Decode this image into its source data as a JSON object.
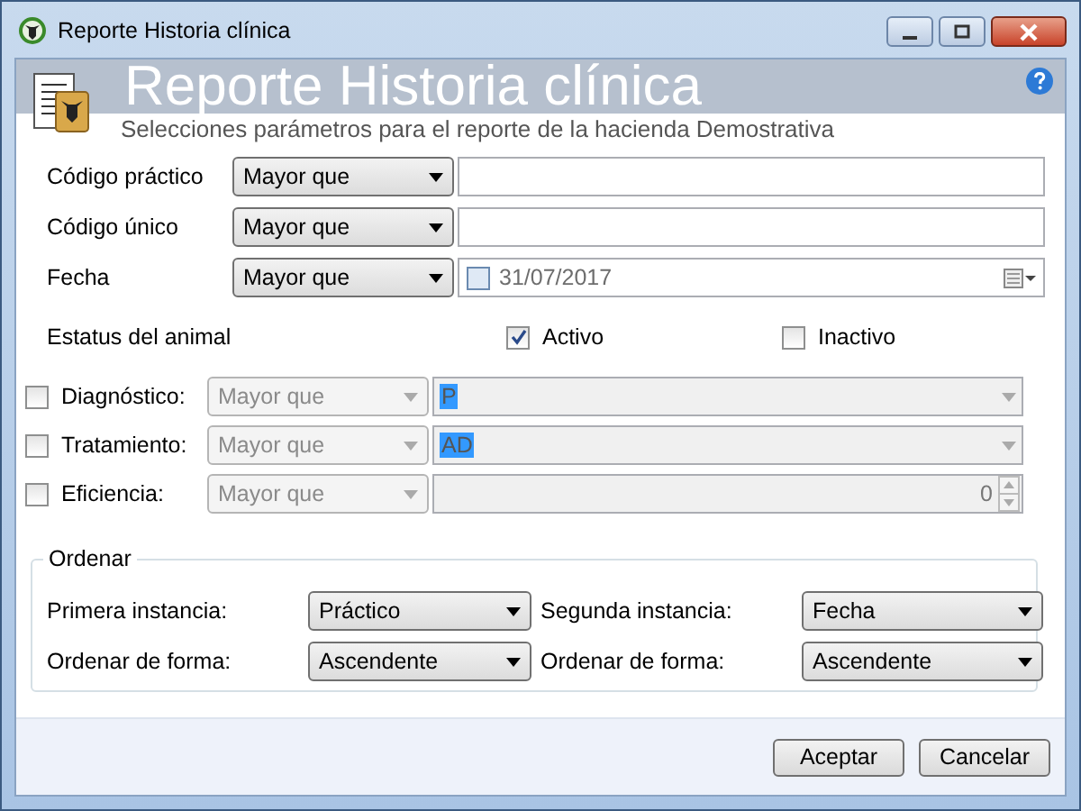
{
  "window": {
    "title": "Reporte Historia clínica"
  },
  "header": {
    "title": "Reporte Historia clínica",
    "subtitle": "Selecciones parámetros para el reporte de la hacienda Demostrativa"
  },
  "filters": [
    {
      "kind": "text",
      "label": "Código práctico",
      "operator": "Mayor que"
    },
    {
      "kind": "text",
      "label": "Código único",
      "operator": "Mayor que"
    },
    {
      "kind": "date",
      "label": "Fecha",
      "operator": "Mayor que",
      "checked": false,
      "value": "31/07/2017"
    }
  ],
  "status": {
    "label": "Estatus del animal",
    "options": [
      {
        "label": "Activo",
        "checked": true
      },
      {
        "label": "Inactivo",
        "checked": false
      }
    ]
  },
  "optional_filters": [
    {
      "kind": "combo",
      "label": "Diagnóstico:",
      "checked": false,
      "operator": "Mayor que",
      "value": "P",
      "text_selected": true
    },
    {
      "kind": "combo",
      "label": "Tratamiento:",
      "checked": false,
      "operator": "Mayor que",
      "value": "AD",
      "text_selected": true
    },
    {
      "kind": "spin",
      "label": "Eficiencia:",
      "checked": false,
      "operator": "Mayor que",
      "value": "0",
      "text_selected": false
    }
  ],
  "sort": {
    "title": "Ordenar",
    "fields": [
      {
        "label": "Primera instancia:",
        "value": "Práctico"
      },
      {
        "label": "Segunda instancia:",
        "value": "Fecha"
      },
      {
        "label": "Ordenar de forma:",
        "value": "Ascendente"
      },
      {
        "label": "Ordenar de forma:",
        "value": "Ascendente"
      }
    ]
  },
  "buttons": [
    "Aceptar",
    "Cancelar"
  ]
}
